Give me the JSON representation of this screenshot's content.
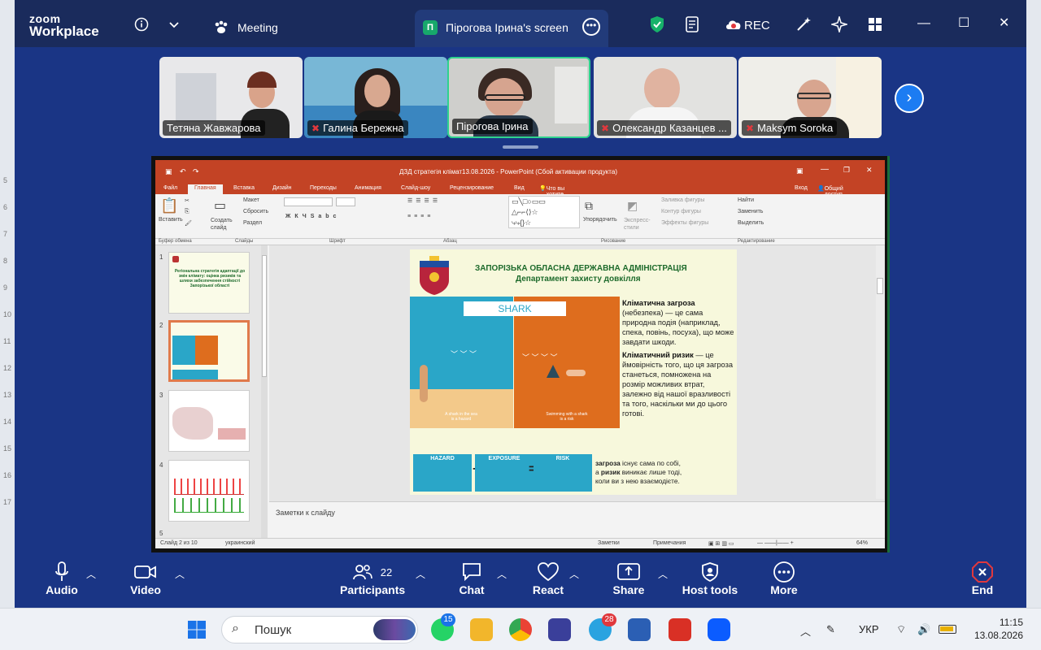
{
  "app": {
    "logo_top": "zoom",
    "logo_bottom": "Workplace",
    "meeting_label": "Meeting",
    "screen_tab_initial": "П",
    "screen_tab_label": "Пірогова Ірина's screen",
    "rec_label": "REC"
  },
  "participants": [
    {
      "name": "Тетяна Жавжарова",
      "muted": false
    },
    {
      "name": "Галина Бережна",
      "muted": true
    },
    {
      "name": "Пірогова Ірина",
      "muted": false
    },
    {
      "name": "Олександр Казанцев ...",
      "muted": true
    },
    {
      "name": "Maksym Soroka",
      "muted": true
    }
  ],
  "powerpoint": {
    "title": "ДЗД стратегія клімат13.08.2026 - PowerPoint (Сбой активации продукта)",
    "tabs": [
      "Файл",
      "Главная",
      "Вставка",
      "Дизайн",
      "Переходы",
      "Анимация",
      "Слайд-шоу",
      "Рецензирование",
      "Вид"
    ],
    "tell_me": "Что вы хотите сделать?",
    "sign_in": "Вход",
    "share": "Общий доступ",
    "ribbon": {
      "paste": "Вставить",
      "new_slide": "Создать слайд",
      "layout": "Макет",
      "reset": "Сбросить",
      "section": "Раздел",
      "arrange": "Упорядочить",
      "quick_styles": "Экспресс-стили",
      "fill": "Заливка фигуры",
      "outline": "Контур фигуры",
      "effects": "Эффекты фигуры",
      "find": "Найти",
      "replace": "Заменить",
      "select": "Выделить"
    },
    "groups": [
      "Буфер обмена",
      "Слайды",
      "Шрифт",
      "Абзац",
      "Рисование",
      "Редактирование"
    ],
    "thumbnails": [
      {
        "num": "1",
        "text": "Регіональна стратегія адаптації до змін клімату: оцінка ризиків та шляхи забезпечення стійкості Запорізької області"
      },
      {
        "num": "2",
        "text": ""
      },
      {
        "num": "3",
        "text": ""
      },
      {
        "num": "4",
        "text": ""
      },
      {
        "num": "5",
        "text": ""
      }
    ],
    "notes_placeholder": "Заметки к слайду",
    "status": {
      "slide": "Слайд 2 из 10",
      "language": "украинский",
      "notes": "Заметки",
      "comments": "Примечания",
      "zoom": "64%"
    },
    "slide": {
      "header1": "ЗАПОРІЗЬКА ОБЛАСНА ДЕРЖАВНА АДМІНІСТРАЦІЯ",
      "header2": "Департамент захисту довкілля",
      "shark": "SHARK",
      "cap_left_1": "A shark in the sea",
      "cap_left_2": "is a hazard",
      "cap_right_1": "Swimming with a shark",
      "cap_right_2": "is a risk",
      "hazard_bold": "Кліматична загроза",
      "hazard_text": "(небезпека) — це сама природна подія (наприклад, спека, повінь, посуха), що може завдати шкоди.",
      "risk_bold": "Кліматичний ризик",
      "risk_text": "— це ймовірність того, що ця загроза станеться, помножена на розмір можливих втрат, залежно від нашої вразливості та того, наскільки ми до цього готові.",
      "strip_hazard": "HAZARD",
      "strip_exposure": "EXPOSURE",
      "strip_risk": "RISK",
      "op_plus": "+",
      "op_eq": "=",
      "foot_b1": "загроза",
      "foot_t1": " існує сама по собі,",
      "foot_t2": "а ",
      "foot_b2": "ризик",
      "foot_t3": " виникає лише тоді,",
      "foot_t4": "коли ви з нею взаємодієте."
    }
  },
  "toolbar": {
    "audio": "Audio",
    "video": "Video",
    "participants": "Participants",
    "participants_count": "22",
    "chat": "Chat",
    "react": "React",
    "share": "Share",
    "host_tools": "Host tools",
    "more": "More",
    "end": "End"
  },
  "taskbar": {
    "search": "Пошук",
    "whatsapp_badge": "15",
    "telegram_badge": "28",
    "lang": "УКР",
    "time": "11:15",
    "date": "13.08.2026"
  },
  "ruler": [
    "5",
    "6",
    "7",
    "8",
    "9",
    "10",
    "11",
    "12",
    "13",
    "14",
    "15",
    "16",
    "17"
  ],
  "colors": {
    "zoom_bar": "#1a2b5c",
    "zoom_body": "#1a3585",
    "accent_green": "#2ed28e",
    "powerpoint_red": "#c34325",
    "end_red": "#e0383d"
  }
}
